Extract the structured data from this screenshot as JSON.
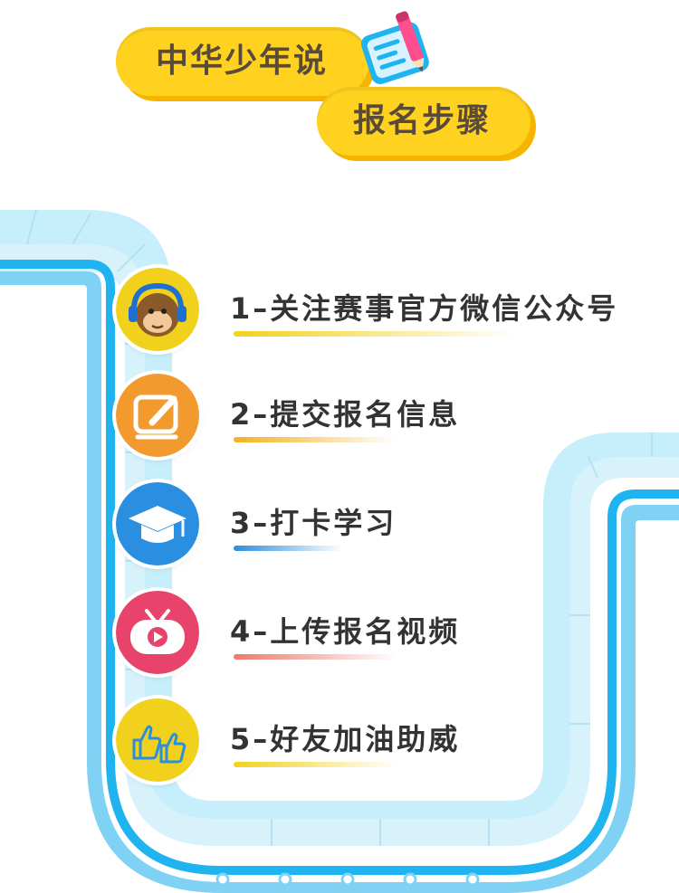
{
  "header": {
    "line1": "中华少年说",
    "line2": "报名步骤"
  },
  "icons": {
    "header": "notepad-pen-icon",
    "step1": "monkey-headphones-icon",
    "step2": "edit-document-icon",
    "step3": "graduation-cap-icon",
    "step4": "tv-play-icon",
    "step5": "thumbs-up-icon"
  },
  "steps": [
    {
      "label": "1–关注赛事官方微信公众号",
      "color": "#f2d11d"
    },
    {
      "label": "2–提交报名信息",
      "color": "#f29a2e"
    },
    {
      "label": "3–打卡学习",
      "color": "#2a8fe0"
    },
    {
      "label": "4–上传报名视频",
      "color": "#e8436b"
    },
    {
      "label": "5–好友加油助威",
      "color": "#f2d11d"
    }
  ],
  "colors": {
    "track": "#b8e8f8",
    "track_edge": "#1fb4f0",
    "pill": "#ffd21f"
  }
}
